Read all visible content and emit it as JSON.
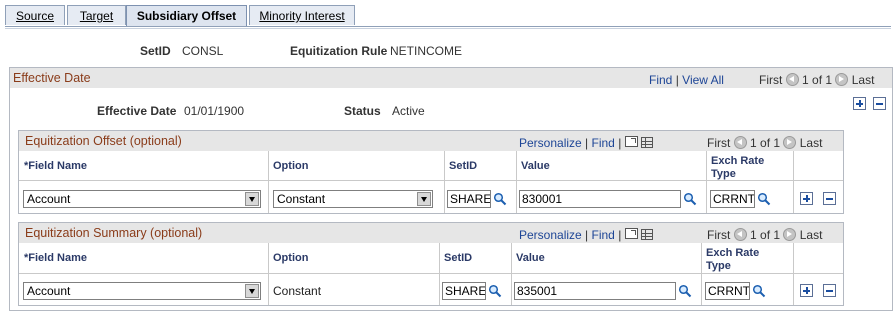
{
  "tabs": [
    {
      "label": "Source",
      "active": false
    },
    {
      "label": "Target",
      "active": false
    },
    {
      "label": "Subsidiary Offset",
      "active": true
    },
    {
      "label": "Minority Interest",
      "active": false
    }
  ],
  "header": {
    "setid_label": "SetID",
    "setid_value": "CONSL",
    "rule_label": "Equitization Rule",
    "rule_value": "NETINCOME"
  },
  "effective": {
    "title": "Effective Date",
    "nav": {
      "find": "Find",
      "sep": "|",
      "view_all": "View All",
      "first": "First",
      "count": "1 of 1",
      "last": "Last"
    },
    "date_label": "Effective Date",
    "date_value": "01/01/1900",
    "status_label": "Status",
    "status_value": "Active"
  },
  "offset": {
    "title": "Equitization Offset (optional)",
    "nav": {
      "personalize": "Personalize",
      "sep": "|",
      "find": "Find",
      "first": "First",
      "count": "1 of 1",
      "last": "Last"
    },
    "columns": {
      "field_name": "*Field Name",
      "option": "Option",
      "setid": "SetID",
      "value": "Value",
      "exch_line1": "Exch Rate",
      "exch_line2": "Type"
    },
    "row": {
      "field_name": "Account",
      "option": "Constant",
      "setid": "SHARE",
      "value": "830001",
      "exch": "CRRNT"
    }
  },
  "summary": {
    "title": "Equitization Summary (optional)",
    "nav": {
      "personalize": "Personalize",
      "sep": "|",
      "find": "Find",
      "first": "First",
      "count": "1 of 1",
      "last": "Last"
    },
    "columns": {
      "field_name": "*Field Name",
      "option": "Option",
      "setid": "SetID",
      "value": "Value",
      "exch_line1": "Exch Rate",
      "exch_line2": "Type"
    },
    "row": {
      "field_name": "Account",
      "option": "Constant",
      "setid": "SHARE",
      "value": "835001",
      "exch": "CRRNT"
    }
  },
  "icons": {
    "lookup": "magnifier-icon",
    "add": "plus-icon",
    "delete": "minus-icon",
    "zoom": "zoom-icon",
    "download": "grid-icon"
  }
}
